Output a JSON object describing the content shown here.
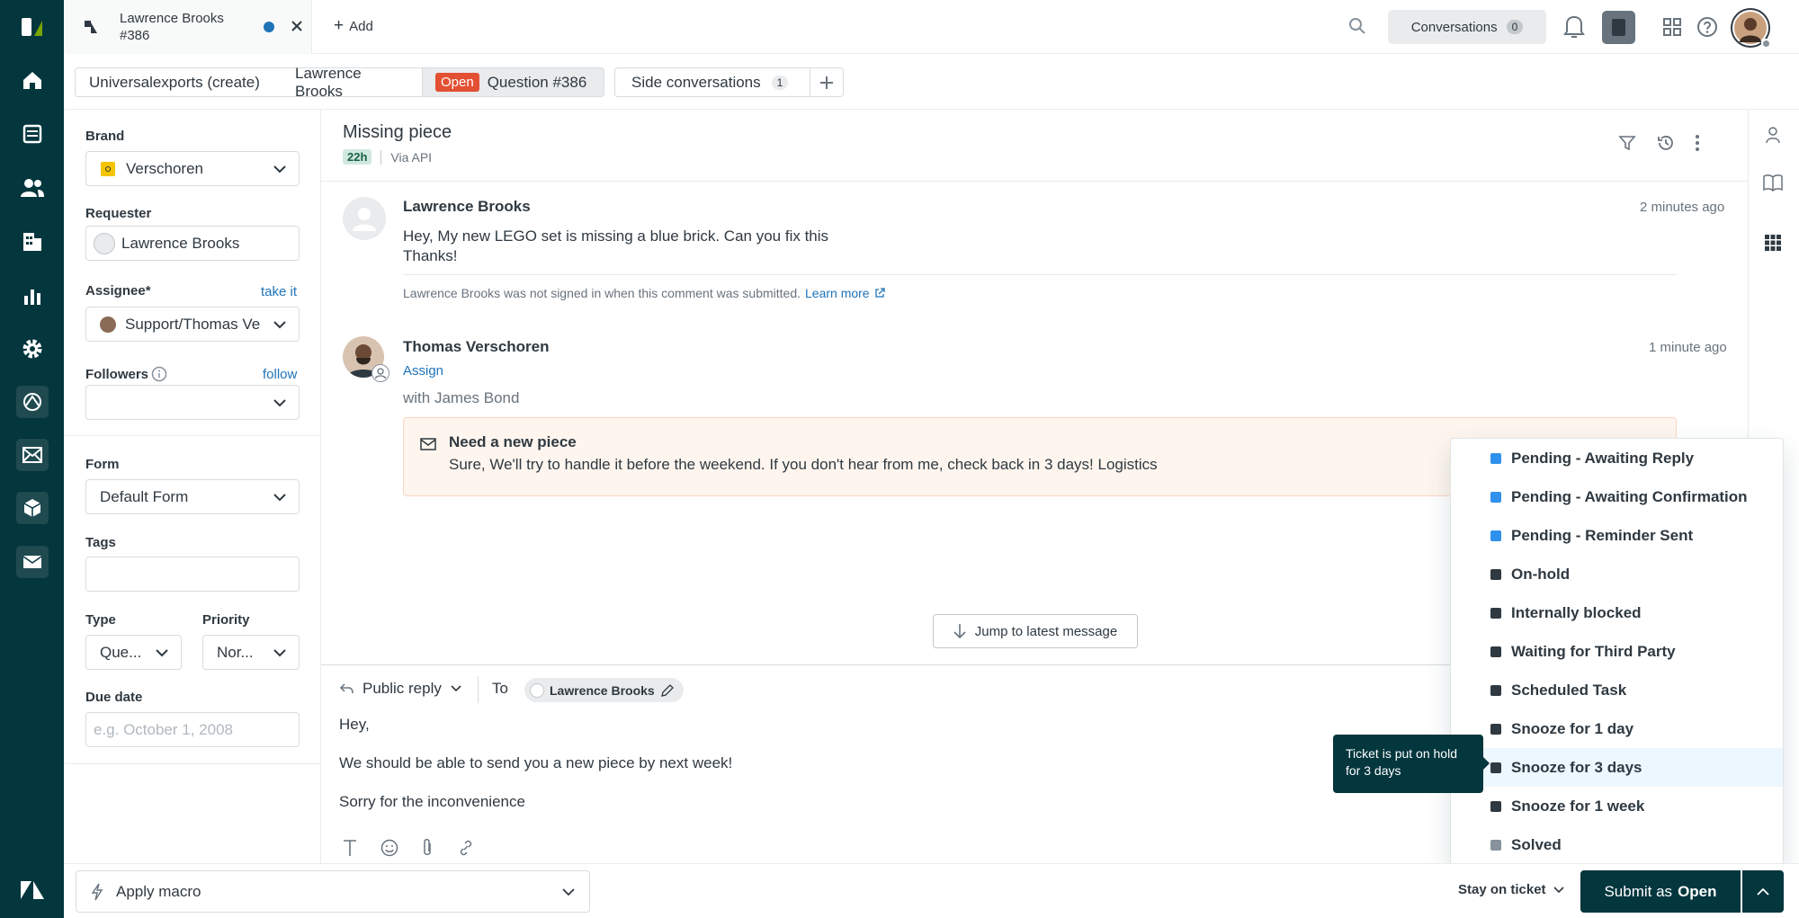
{
  "tab": {
    "title": "Lawrence Brooks",
    "subtitle": "#386",
    "add_label": "Add"
  },
  "topbar": {
    "conversations_label": "Conversations",
    "conversations_count": "0"
  },
  "breadcrumbs": {
    "org": "Universalexports (create)",
    "requester": "Lawrence Brooks",
    "status_badge": "Open",
    "ticket": "Question #386",
    "side_conversations": "Side conversations",
    "side_count": "1"
  },
  "left_panel": {
    "brand_label": "Brand",
    "brand_value": "Verschoren",
    "requester_label": "Requester",
    "requester_value": "Lawrence Brooks",
    "assignee_label": "Assignee*",
    "take_it": "take it",
    "assignee_value": "Support/Thomas Ve",
    "followers_label": "Followers",
    "follow": "follow",
    "form_label": "Form",
    "form_value": "Default Form",
    "tags_label": "Tags",
    "type_label": "Type",
    "type_value": "Que...",
    "priority_label": "Priority",
    "priority_value": "Nor...",
    "due_label": "Due date",
    "due_placeholder": "e.g. October 1, 2008"
  },
  "ticket": {
    "subject": "Missing piece",
    "age_badge": "22h",
    "channel": "Via API"
  },
  "messages": [
    {
      "author": "Lawrence Brooks",
      "time": "2 minutes ago",
      "line1": "Hey, My new LEGO set is missing a blue brick. Can you fix this",
      "line2": "Thanks!",
      "note": "Lawrence Brooks was not signed in when this comment was submitted.",
      "note_link": "Learn more"
    },
    {
      "author": "Thomas Verschoren",
      "time": "1 minute ago",
      "assign": "Assign",
      "with": "with James Bond",
      "side_title": "Need a new piece",
      "side_body": "Sure, We'll try to handle it before the weekend. If you don't hear from me, check back in 3 days! Logistics"
    }
  ],
  "jump_label": "Jump to latest message",
  "composer": {
    "mode": "Public reply",
    "to_label": "To",
    "recipient": "Lawrence Brooks",
    "line1": "Hey,",
    "line2": "We should be able to send you a new piece by next week!",
    "line3": "Sorry for the inconvenience"
  },
  "status_menu": [
    {
      "label": "Pending - Awaiting Reply",
      "color": "#3091ec"
    },
    {
      "label": "Pending - Awaiting Confirmation",
      "color": "#3091ec"
    },
    {
      "label": "Pending - Reminder Sent",
      "color": "#3091ec"
    },
    {
      "label": "On-hold",
      "color": "#2f3941"
    },
    {
      "label": "Internally blocked",
      "color": "#2f3941"
    },
    {
      "label": "Waiting for Third Party",
      "color": "#2f3941"
    },
    {
      "label": "Scheduled Task",
      "color": "#2f3941"
    },
    {
      "label": "Snooze for 1 day",
      "color": "#2f3941"
    },
    {
      "label": "Snooze for 3 days",
      "color": "#2f3941"
    },
    {
      "label": "Snooze for 1 week",
      "color": "#2f3941"
    },
    {
      "label": "Solved",
      "color": "#87929d"
    }
  ],
  "tooltip": {
    "line1": "Ticket is put on hold",
    "line2": "for 3 days"
  },
  "bottom": {
    "macro": "Apply macro",
    "stay": "Stay on ticket",
    "submit_prefix": "Submit as",
    "submit_status": "Open"
  },
  "colors": {
    "nav_bg": "#03363d",
    "accent": "#1f73b7",
    "open_badge": "#e34f32",
    "submit_bg": "#03363d"
  }
}
